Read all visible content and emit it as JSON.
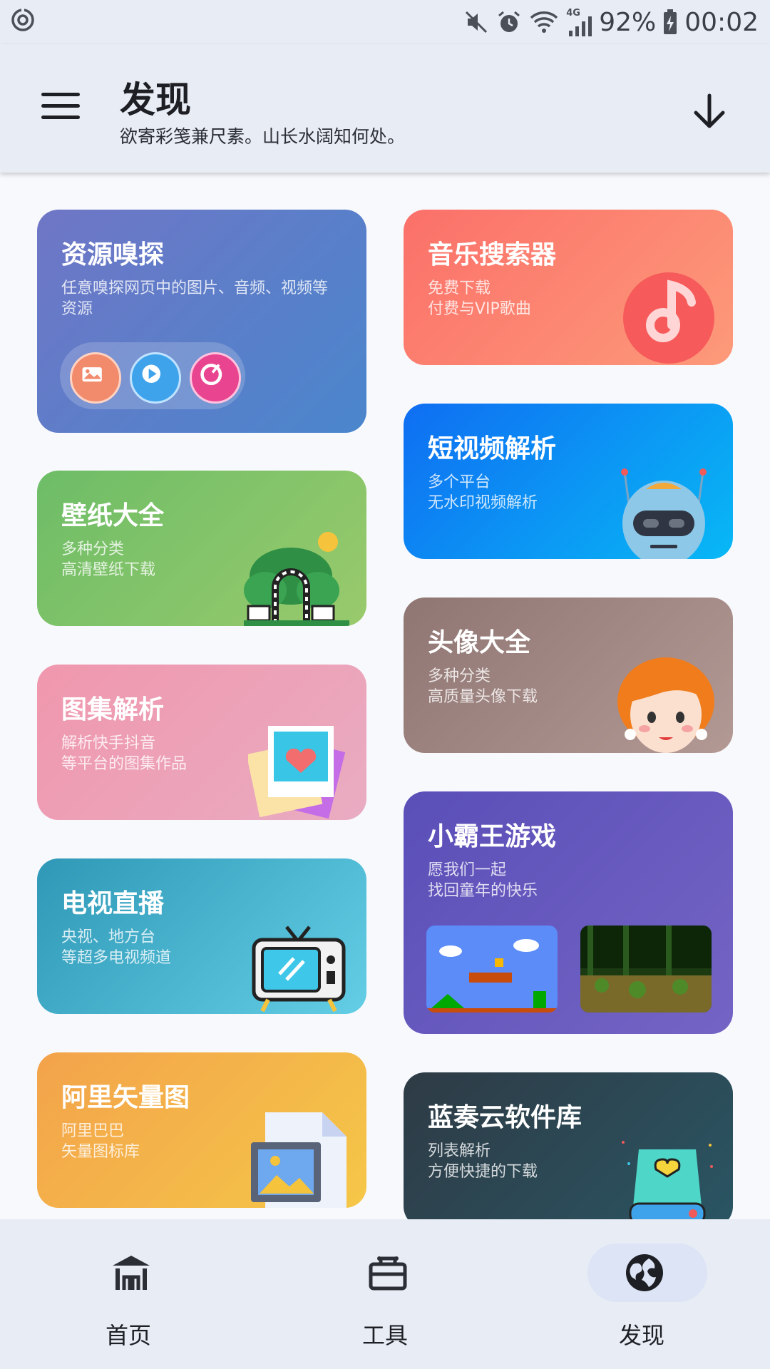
{
  "status_bar": {
    "battery_percent": "92%",
    "time": "00:02",
    "network_label": "4G",
    "icons": [
      "sync-icon",
      "mute-icon",
      "alarm-icon",
      "wifi-icon",
      "signal-icon",
      "battery-charging-icon"
    ]
  },
  "app_bar": {
    "title": "发现",
    "subtitle": "欲寄彩笺兼尺素。山长水阔知何处。",
    "menu_icon": "menu-icon",
    "action_icon": "arrow-down-icon"
  },
  "cards": [
    {
      "id": "resource-sniffer",
      "title": "资源嗅探",
      "desc": [
        "任意嗅探网页中的图片、音频、视频等",
        "资源"
      ],
      "colors": [
        "#6f76c6",
        "#4a86cc"
      ]
    },
    {
      "id": "music-search",
      "title": "音乐搜索器",
      "desc": [
        "免费下载",
        "付费与VIP歌曲"
      ],
      "colors": [
        "#fb7069",
        "#fd9a7a"
      ]
    },
    {
      "id": "short-video",
      "title": "短视频解析",
      "desc": [
        "多个平台",
        "无水印视频解析"
      ],
      "colors": [
        "#0f6ef2",
        "#08b8f5"
      ]
    },
    {
      "id": "wallpaper",
      "title": "壁纸大全",
      "desc": [
        "多种分类",
        "高清壁纸下载"
      ],
      "colors": [
        "#6dbd67",
        "#99ca6c"
      ]
    },
    {
      "id": "avatar",
      "title": "头像大全",
      "desc": [
        "多种分类",
        "高质量头像下载"
      ],
      "colors": [
        "#8f7673",
        "#b39994"
      ]
    },
    {
      "id": "gallery",
      "title": "图集解析",
      "desc": [
        "解析快手抖音",
        "等平台的图集作品"
      ],
      "colors": [
        "#f097ad",
        "#e9acc2"
      ]
    },
    {
      "id": "nes-games",
      "title": "小霸王游戏",
      "desc": [
        "愿我们一起",
        "找回童年的快乐"
      ],
      "colors": [
        "#5a4fb8",
        "#7464c4"
      ]
    },
    {
      "id": "tv-live",
      "title": "电视直播",
      "desc": [
        "央视、地方台",
        "等超多电视频道"
      ],
      "colors": [
        "#2f98b6",
        "#64cee6"
      ]
    },
    {
      "id": "ali-icons",
      "title": "阿里矢量图",
      "desc": [
        "阿里巴巴",
        "矢量图标库"
      ],
      "colors": [
        "#f3a34b",
        "#f5c748"
      ]
    },
    {
      "id": "lanzou",
      "title": "蓝奏云软件库",
      "desc": [
        "列表解析",
        "方便快捷的下载"
      ],
      "colors": [
        "#2e3b45",
        "#2a5563"
      ]
    }
  ],
  "bottom_nav": {
    "items": [
      {
        "label": "首页",
        "icon": "home-icon",
        "selected": false
      },
      {
        "label": "工具",
        "icon": "toolbox-icon",
        "selected": false
      },
      {
        "label": "发现",
        "icon": "globe-icon",
        "selected": true
      }
    ],
    "selected_pill_color": "#dce4f6"
  }
}
